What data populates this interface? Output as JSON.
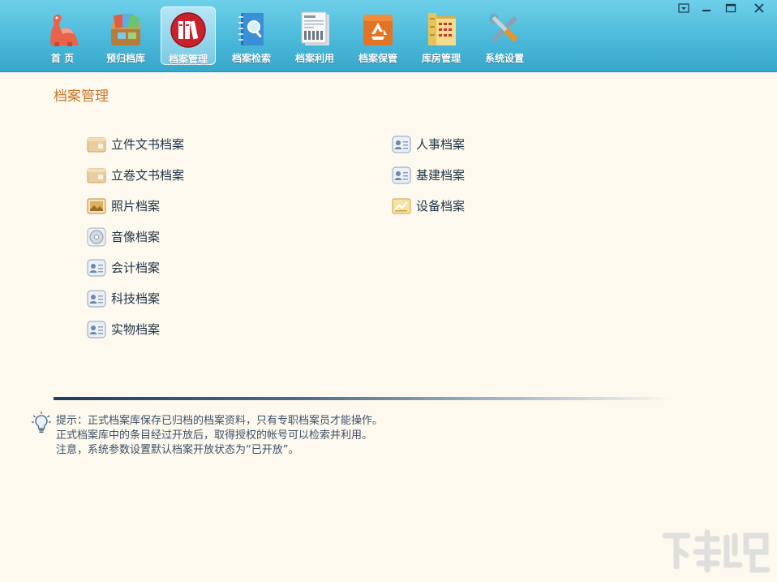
{
  "toolbar": {
    "items": [
      {
        "label": "首 页",
        "icon": "dinosaur-icon"
      },
      {
        "label": "预归档库",
        "icon": "pre-archive-box-icon"
      },
      {
        "label": "档案管理",
        "icon": "archive-binders-icon",
        "active": true
      },
      {
        "label": "档案检索",
        "icon": "search-notebook-icon"
      },
      {
        "label": "档案利用",
        "icon": "article-document-icon"
      },
      {
        "label": "档案保管",
        "icon": "recycle-box-icon"
      },
      {
        "label": "库房管理",
        "icon": "storage-shelves-icon"
      },
      {
        "label": "系统设置",
        "icon": "wrench-screwdriver-icon"
      }
    ],
    "window_controls": [
      "menu-icon",
      "minimize-icon",
      "maximize-icon",
      "close-icon"
    ]
  },
  "main": {
    "title": "档案管理",
    "left_column": [
      {
        "label": "立件文书档案",
        "icon": "folder-doc-icon"
      },
      {
        "label": "立卷文书档案",
        "icon": "folder-doc-icon"
      },
      {
        "label": "照片档案",
        "icon": "photo-icon"
      },
      {
        "label": "音像档案",
        "icon": "disc-icon"
      },
      {
        "label": "会计档案",
        "icon": "id-card-icon"
      },
      {
        "label": "科技档案",
        "icon": "id-card-icon"
      },
      {
        "label": "实物档案",
        "icon": "id-card-icon"
      }
    ],
    "right_column": [
      {
        "label": "人事档案",
        "icon": "id-card-icon"
      },
      {
        "label": "基建档案",
        "icon": "id-card-icon"
      },
      {
        "label": "设备档案",
        "icon": "equipment-chart-icon"
      }
    ]
  },
  "tips": {
    "line1": "提示：正式档案库保存已归档的档案资料，只有专职档案员才能操作。",
    "line2": "正式档案库中的条目经过开放后，取得授权的帐号可以检索并利用。",
    "line3": "注意，系统参数设置默认档案开放状态为“已开放”。"
  },
  "colors": {
    "toolbar": "#48b7d8",
    "background": "#fdf9ef",
    "title": "#c6782e",
    "link_text": "#1f3346",
    "tip_text": "#3d5166"
  }
}
